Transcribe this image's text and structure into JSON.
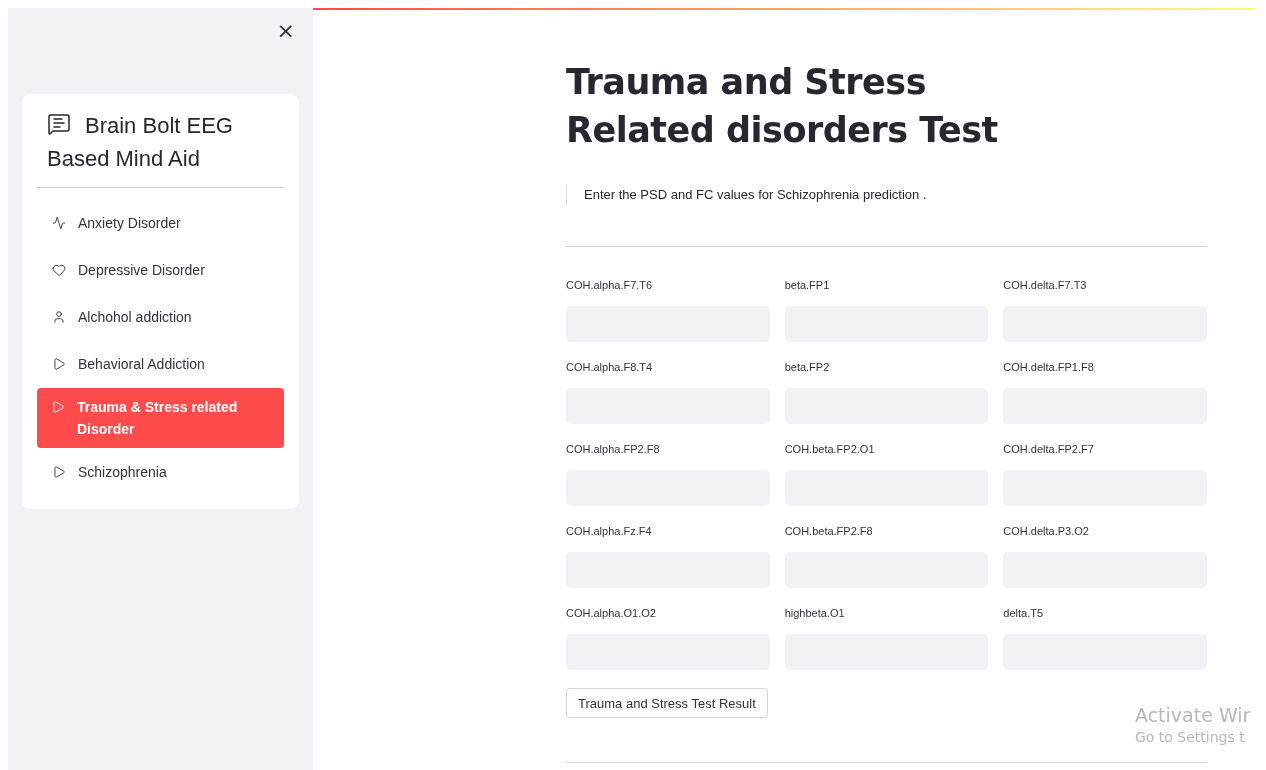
{
  "sidebar": {
    "close_label": "×",
    "title": "Brain Bolt EEG Based Mind Aid",
    "items": [
      {
        "label": "Anxiety Disorder",
        "kind": "pulse",
        "selected": false
      },
      {
        "label": "Depressive Disorder",
        "kind": "heart",
        "selected": false
      },
      {
        "label": "Alchohol addiction",
        "kind": "person",
        "selected": false
      },
      {
        "label": "Behavioral Addiction",
        "kind": "play",
        "selected": false
      },
      {
        "label": "Trauma & Stress related Disorder",
        "kind": "play",
        "selected": true
      },
      {
        "label": "Schizophrenia",
        "kind": "play",
        "selected": false
      }
    ]
  },
  "main": {
    "title": "Trauma and Stress Related disorders Test",
    "info": "Enter the PSD and FC values for Schizophrenia prediction .",
    "fields": [
      {
        "label": "COH.alpha.F7.T6"
      },
      {
        "label": "beta.FP1"
      },
      {
        "label": "COH.delta.F7.T3"
      },
      {
        "label": "COH.alpha.F8.T4"
      },
      {
        "label": "beta.FP2"
      },
      {
        "label": "COH.delta.FP1.F8"
      },
      {
        "label": "COH.alpha.FP2.F8"
      },
      {
        "label": "COH.beta.FP2.O1"
      },
      {
        "label": "COH.delta.FP2.F7"
      },
      {
        "label": "COH.alpha.Fz.F4"
      },
      {
        "label": "COH.beta.FP2.F8"
      },
      {
        "label": "COH.delta.P3.O2"
      },
      {
        "label": "COH.alpha.O1.O2"
      },
      {
        "label": "highbeta.O1"
      },
      {
        "label": "delta.T5"
      }
    ],
    "button": "Trauma and Stress Test Result"
  },
  "os_notice": {
    "title": "Activate Wir",
    "subtitle": "Go to Settings t"
  }
}
